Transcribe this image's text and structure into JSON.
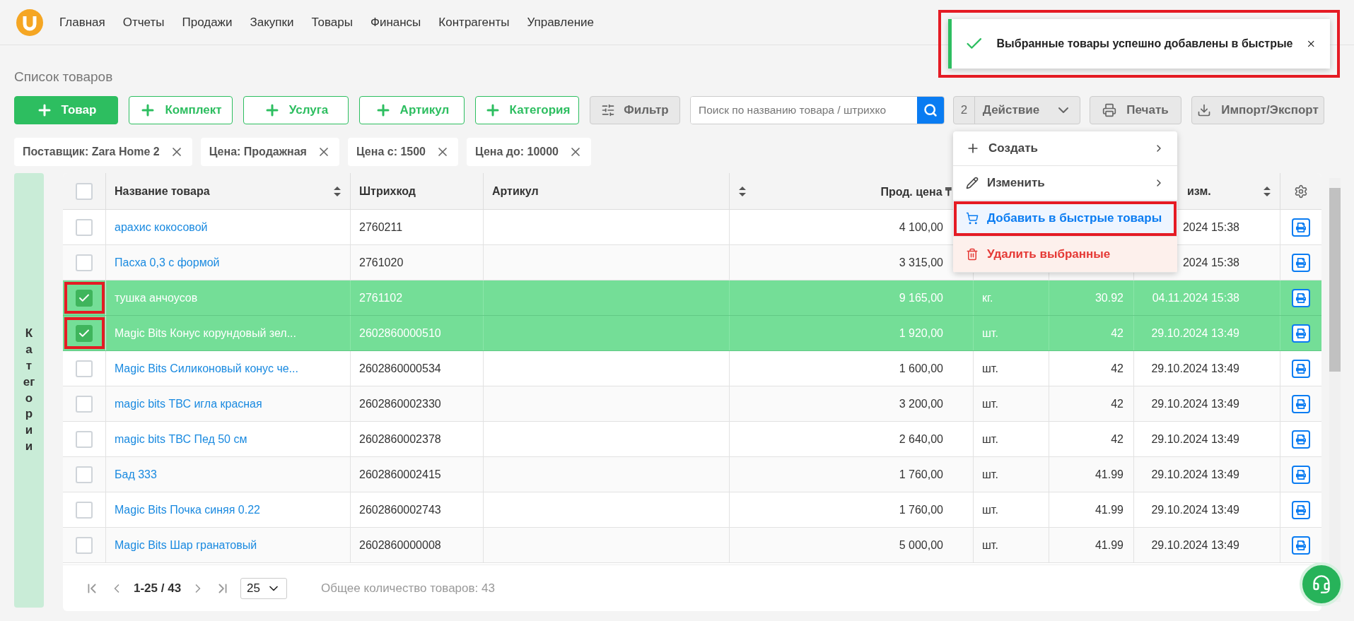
{
  "nav": {
    "items": [
      "Главная",
      "Отчеты",
      "Продажи",
      "Закупки",
      "Товары",
      "Финансы",
      "Контрагенты",
      "Управление"
    ]
  },
  "toast": {
    "message": "Выбранные товары успешно добавлены в быстрые",
    "highlighted": true
  },
  "page_title": "Список товаров",
  "toolbar": {
    "buttons": [
      {
        "label": "Товар",
        "kind": "primary"
      },
      {
        "label": "Комплект",
        "kind": "outline"
      },
      {
        "label": "Услуга",
        "kind": "outline"
      },
      {
        "label": "Артикул",
        "kind": "outline"
      },
      {
        "label": "Категория",
        "kind": "outline"
      },
      {
        "label": "Фильтр",
        "kind": "filter"
      }
    ],
    "search": {
      "placeholder": "Поиск по названию товара / штрихко"
    },
    "action": {
      "count": "2",
      "label": "Действие",
      "expanded": true
    },
    "print": "Печать",
    "import": "Импорт/Экспорт"
  },
  "filters": [
    "Поставщик: Zara Home 2",
    "Цена: Продажная",
    "Цена с: 1500",
    "Цена до: 10000"
  ],
  "sidebar": {
    "label": "Категории"
  },
  "menu": {
    "items": [
      {
        "label": "Создать",
        "kind": "create",
        "highlighted": false
      },
      {
        "label": "Изменить",
        "kind": "edit",
        "highlighted": false
      },
      {
        "label": "Добавить в быстрые товары",
        "kind": "add",
        "highlighted": true
      },
      {
        "label": "Удалить выбранные",
        "kind": "delete",
        "highlighted": false
      }
    ]
  },
  "table": {
    "select_all": {
      "checked": false
    },
    "columns": [
      {
        "kind": "check"
      },
      {
        "kind": "name",
        "label": "Название товара",
        "sortable": true
      },
      {
        "kind": "text",
        "label": "Штрихкод"
      },
      {
        "kind": "text",
        "label": "Артикул"
      },
      {
        "kind": "price",
        "label": "Прод. цена ₸",
        "sortable": true
      },
      {
        "kind": "text"
      },
      {
        "kind": "text"
      },
      {
        "kind": "date",
        "label": "изм.",
        "sortable": true
      },
      {
        "kind": "settings"
      }
    ],
    "rows": [
      {
        "selected": false,
        "highlighted": false,
        "name": "арахис кокосовой",
        "barcode": "2760211",
        "price": "4 100,00",
        "date": "2024 15:38"
      },
      {
        "selected": false,
        "highlighted": false,
        "name": "Пасха 0,3 с формой",
        "barcode": "2761020",
        "price": "3 315,00",
        "date": "2024 15:38"
      },
      {
        "selected": true,
        "highlighted": true,
        "name": "тушка анчоусов",
        "barcode": "2761102",
        "price": "9 165,00",
        "unit": "кг.",
        "qty": "30.92",
        "date": "04.11.2024 15:38"
      },
      {
        "selected": true,
        "highlighted": true,
        "name": "Magic Bits Конус корундовый зел...",
        "barcode": "2602860000510",
        "price": "1 920,00",
        "unit": "шт.",
        "qty": "42",
        "date": "29.10.2024 13:49"
      },
      {
        "selected": false,
        "highlighted": false,
        "name": "Magic Bits Силиконовый конус че...",
        "barcode": "2602860000534",
        "price": "1 600,00",
        "unit": "шт.",
        "qty": "42",
        "date": "29.10.2024 13:49"
      },
      {
        "selected": false,
        "highlighted": false,
        "name": "magic bits ТВС игла красная",
        "barcode": "2602860002330",
        "price": "3 200,00",
        "unit": "шт.",
        "qty": "42",
        "date": "29.10.2024 13:49"
      },
      {
        "selected": false,
        "highlighted": false,
        "name": "magic bits ТВС Пед 50 см",
        "barcode": "2602860002378",
        "price": "2 640,00",
        "unit": "шт.",
        "qty": "42",
        "date": "29.10.2024 13:49"
      },
      {
        "selected": false,
        "highlighted": false,
        "name": "Бад 333",
        "barcode": "2602860002415",
        "price": "1 760,00",
        "unit": "шт.",
        "qty": "41.99",
        "date": "29.10.2024 13:49"
      },
      {
        "selected": false,
        "highlighted": false,
        "name": "Magic Bits Почка синяя 0.22",
        "barcode": "2602860002743",
        "price": "1 760,00",
        "unit": "шт.",
        "qty": "41.99",
        "date": "29.10.2024 13:49"
      },
      {
        "selected": false,
        "highlighted": false,
        "name": "Magic Bits Шар гранатовый",
        "barcode": "2602860000008",
        "price": "5 000,00",
        "unit": "шт.",
        "qty": "41.99",
        "date": "29.10.2024 13:49"
      }
    ]
  },
  "pagination": {
    "range": "1-25 / 43",
    "page_size": "25",
    "total": "Общее количество товаров: 43"
  }
}
